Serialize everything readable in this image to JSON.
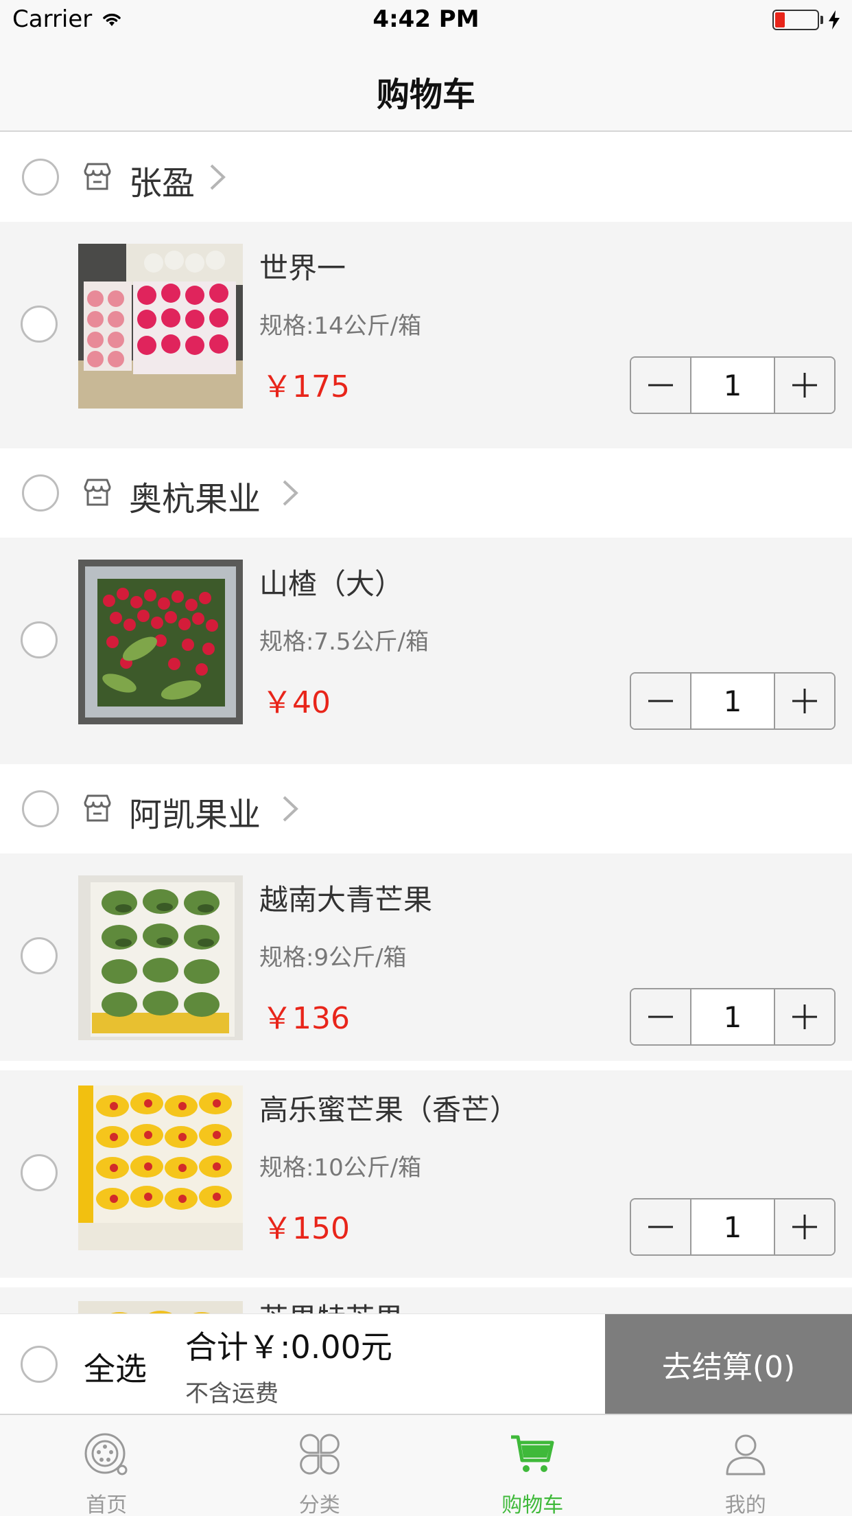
{
  "status_bar": {
    "carrier": "Carrier",
    "time": "4:42 PM",
    "icons": [
      "wifi-icon",
      "battery-icon",
      "charging-bolt-icon"
    ]
  },
  "nav": {
    "title": "购物车"
  },
  "groups": [
    {
      "shop": "张盈",
      "items": [
        {
          "name": "世界一",
          "spec": "规格:14公斤/箱",
          "price": "￥175",
          "qty": "1",
          "image": "apples-box"
        }
      ]
    },
    {
      "shop": "奥杭果业",
      "items": [
        {
          "name": "山楂（大）",
          "spec": "规格:7.5公斤/箱",
          "price": "￥40",
          "qty": "1",
          "image": "hawthorn-box"
        }
      ]
    },
    {
      "shop": "阿凯果业",
      "items": [
        {
          "name": "越南大青芒果",
          "spec": "规格:9公斤/箱",
          "price": "￥136",
          "qty": "1",
          "image": "green-mango-box"
        },
        {
          "name": "高乐蜜芒果（香芒）",
          "spec": "规格:10公斤/箱",
          "price": "￥150",
          "qty": "1",
          "image": "yellow-mango-box"
        }
      ]
    }
  ],
  "partial_item": {
    "name": "芒果特芒果"
  },
  "checkout": {
    "select_all": "全选",
    "total": "合计￥:0.00元",
    "freight_note": "不含运费",
    "button": "去结算(0)"
  },
  "tabs": [
    {
      "label": "首页",
      "icon": "home-icon",
      "active": false
    },
    {
      "label": "分类",
      "icon": "category-icon",
      "active": false
    },
    {
      "label": "购物车",
      "icon": "cart-icon",
      "active": true
    },
    {
      "label": "我的",
      "icon": "profile-icon",
      "active": false
    }
  ],
  "colors": {
    "accent": "#3fb93a",
    "price": "#e8251a",
    "checkout_button": "#7d7d7d"
  }
}
